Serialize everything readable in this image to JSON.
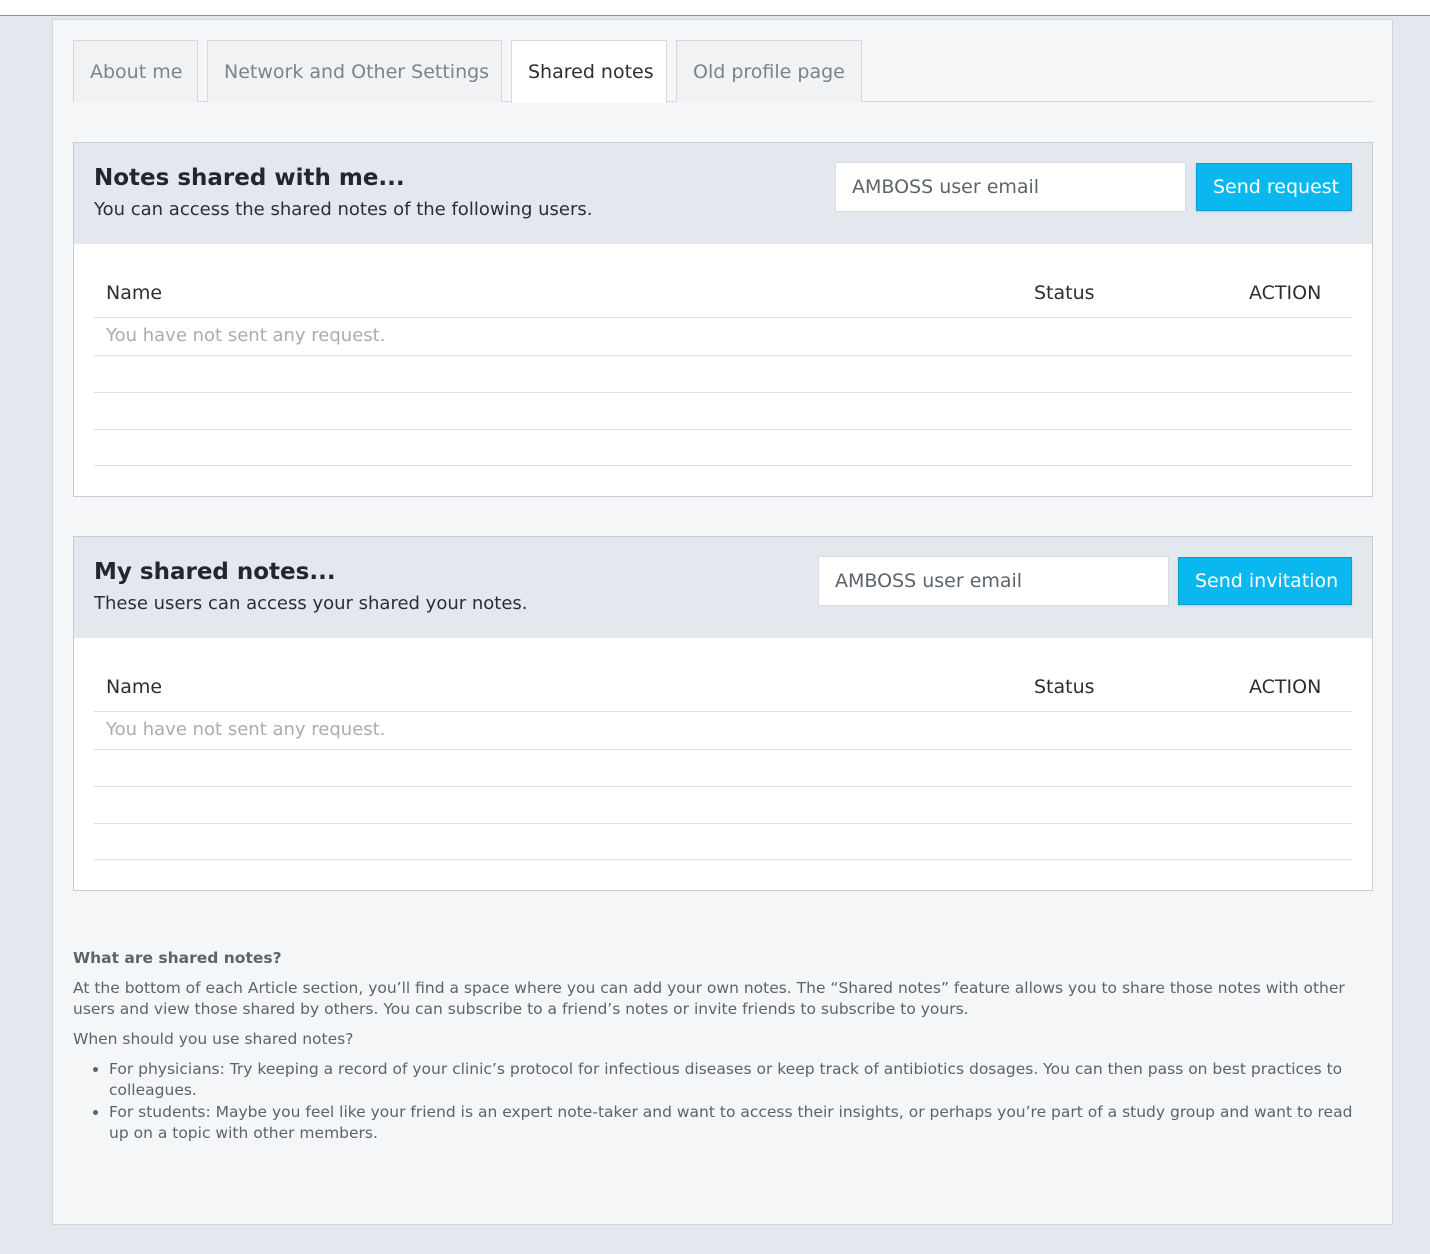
{
  "tabs": [
    {
      "label": "About me",
      "active": false
    },
    {
      "label": "Network and Other Settings",
      "active": false
    },
    {
      "label": "Shared notes",
      "active": true
    },
    {
      "label": "Old profile page",
      "active": false
    }
  ],
  "shared_with_me": {
    "title": "Notes shared with me...",
    "subtitle": "You can access the shared notes of the following users.",
    "email_placeholder": "AMBOSS user email",
    "button_label": "Send request",
    "columns": {
      "name": "Name",
      "status": "Status",
      "action": "ACTION"
    },
    "empty_text": "You have not sent any request."
  },
  "my_shared": {
    "title": "My shared notes...",
    "subtitle": "These users can access your shared your notes.",
    "email_placeholder": "AMBOSS user email",
    "button_label": "Send invitation",
    "columns": {
      "name": "Name",
      "status": "Status",
      "action": "ACTION"
    },
    "empty_text": "You have not sent any request."
  },
  "info": {
    "question1": "What are shared notes?",
    "paragraph": "At the bottom of each Article section, you’ll find a space where you can add your own notes. The “Shared notes” feature allows you to share those notes with other users and view those shared by others. You can subscribe to a friend’s notes or invite friends to subscribe to yours.",
    "question2": "When should you use shared notes?",
    "bullets": [
      "For physicians: Try keeping a record of your clinic’s protocol for infectious diseases or keep track of antibiotics dosages. You can then pass on best practices to colleagues.",
      "For students: Maybe you feel like your friend is an expert note-taker and want to access their insights, or perhaps you’re part of a study group and want to read up on a topic with other members."
    ]
  },
  "colors": {
    "accent": "#0ab7ee",
    "panel_header": "#e3e8ef",
    "background": "#e3e8ef"
  }
}
